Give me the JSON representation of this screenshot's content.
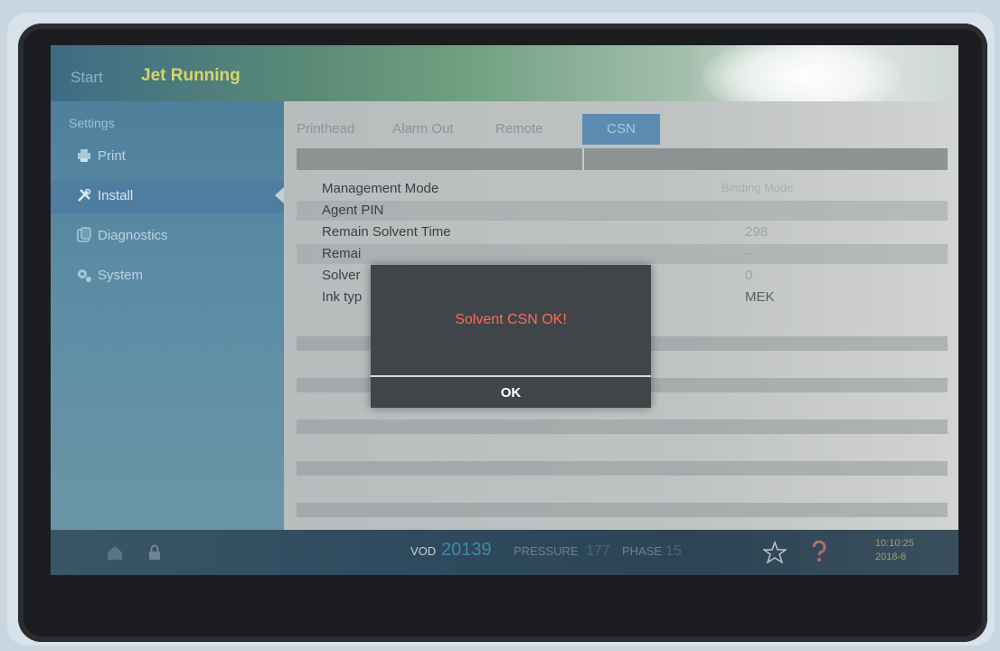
{
  "header": {
    "start_label": "Start",
    "status": "Jet Running"
  },
  "sidebar": {
    "heading": "Settings",
    "items": [
      {
        "label": "Print",
        "icon": "printer-icon"
      },
      {
        "label": "Install",
        "icon": "wrench-icon",
        "active": true
      },
      {
        "label": "Diagnostics",
        "icon": "diagnostics-icon"
      },
      {
        "label": "System",
        "icon": "gears-icon"
      }
    ]
  },
  "tabs": [
    {
      "label": "Printhead"
    },
    {
      "label": "Alarm Out"
    },
    {
      "label": "Remote"
    },
    {
      "label": "CSN",
      "active": true
    }
  ],
  "settings": {
    "rows": [
      {
        "label": "Management Mode",
        "value": "Binding Mode"
      },
      {
        "label": "Agent PIN",
        "value": ""
      },
      {
        "label": "Remain Solvent Time",
        "value": "298"
      },
      {
        "label": "Remai",
        "value": "--"
      },
      {
        "label": "Solver",
        "value": "0"
      },
      {
        "label": "Ink typ",
        "value": "MEK"
      }
    ]
  },
  "dialog": {
    "message": "Solvent CSN OK!",
    "ok_label": "OK"
  },
  "status_bar": {
    "vod_label": "VOD",
    "vod_value": "20139",
    "pressure_label": "PRESSURE",
    "pressure_value": "177",
    "phase_label": "PHASE",
    "phase_value": "15",
    "time": "10:10:25",
    "date": "2018-6"
  },
  "colors": {
    "dialog_message": "#ff6a5a",
    "status_running": "#d7d46a",
    "vod_value": "#3c8aa6"
  }
}
